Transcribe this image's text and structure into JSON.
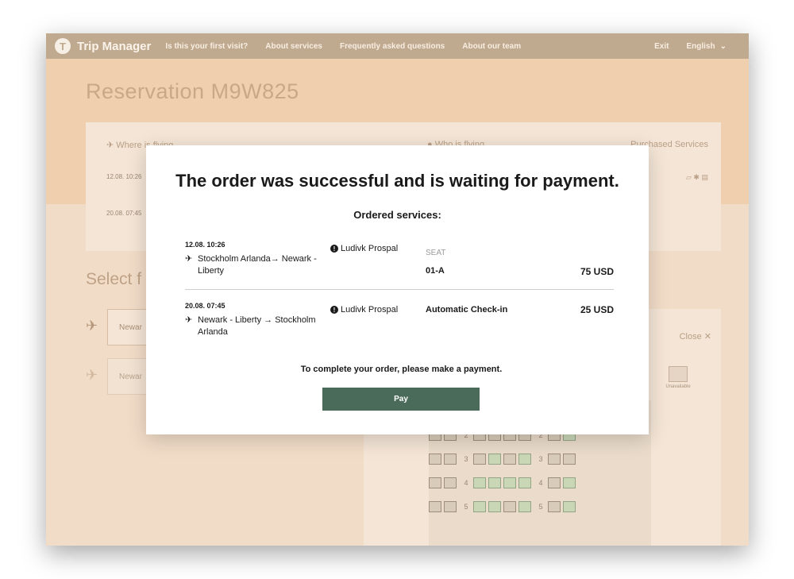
{
  "app": {
    "title": "Trip Manager",
    "logo_letter": "T"
  },
  "nav": {
    "items": [
      "Is this your first visit?",
      "About services",
      "Frequently asked questions",
      "About our team"
    ],
    "exit_label": "Exit",
    "language": "English"
  },
  "reservation": {
    "title": "Reservation M9W825"
  },
  "flights_panel": {
    "where_label": "Where is flying",
    "who_label": "Who is flying",
    "purchased_label": "Purchased Services",
    "row1_date": "12.08. 10:26",
    "row2_date": "20.08. 07:45"
  },
  "select_section": {
    "title_partial": "Select f",
    "field1_value": "Newar",
    "field2_value": "Newar"
  },
  "seat_panel": {
    "close_label": "Close",
    "unavailable_label": "Unavailable",
    "row_numbers": [
      "2",
      "3",
      "4",
      "5"
    ]
  },
  "modal": {
    "title": "The order was successful and is waiting for payment.",
    "subtitle": "Ordered services:",
    "orders": [
      {
        "date": "12.08. 10:26",
        "route": "Stockholm Arlanda→ Newark - Liberty",
        "passenger": "Ludivk Prospal",
        "service_label": "SEAT",
        "service_value": "01-A",
        "price": "75 USD"
      },
      {
        "date": "20.08. 07:45",
        "route": "Newark - Liberty → Stockholm Arlanda",
        "passenger": "Ludivk Prospal",
        "service_label": "",
        "service_value": "Automatic Check-in",
        "price": "25 USD"
      }
    ],
    "note": "To complete your order, please make a payment.",
    "pay_label": "Pay"
  },
  "colors": {
    "topbar": "#bfa98f",
    "backdrop": "#f1dcc7",
    "pay_button": "#4b6b5a",
    "seat_free": "#c9d7b7"
  },
  "icons": {
    "plane": "airplane-icon",
    "info": "info-icon",
    "close": "close-icon",
    "chevron": "chevron-down-icon"
  }
}
